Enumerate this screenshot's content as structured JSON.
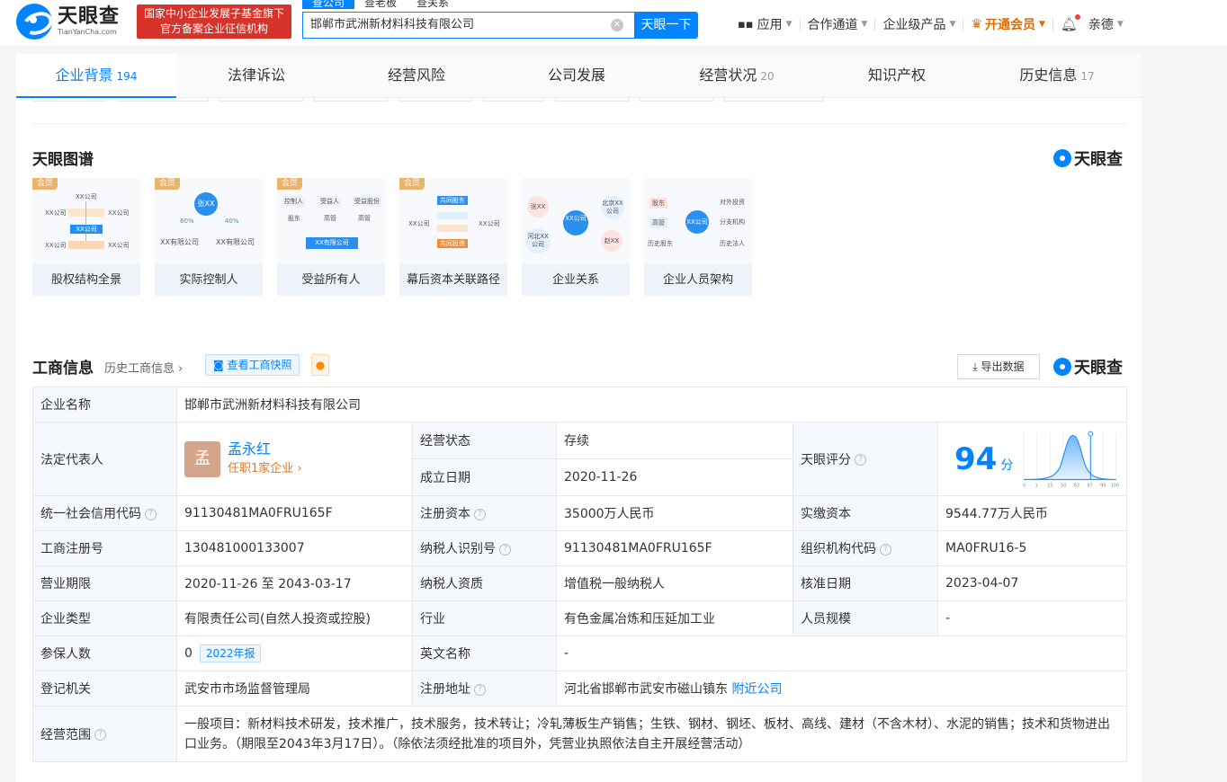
{
  "header": {
    "logo_cn": "天眼查",
    "logo_en": "TianYanCha.com",
    "gov_badge_line1": "国家中小企业发展子基金旗下",
    "gov_badge_line2": "官方备案企业征信机构",
    "search_tabs": [
      "查公司",
      "查老板",
      "查关系"
    ],
    "search_value": "邯郸市武洲新材料科技有限公司",
    "search_button": "天眼一下",
    "nav": {
      "apps": "应用",
      "partner": "合作通道",
      "enterprise": "企业级产品",
      "vip": "开通会员",
      "user": "亲德"
    }
  },
  "tabs": [
    {
      "label": "企业背景",
      "count": "194"
    },
    {
      "label": "法律诉讼",
      "count": ""
    },
    {
      "label": "经营风险",
      "count": ""
    },
    {
      "label": "公司发展",
      "count": ""
    },
    {
      "label": "经营状况",
      "count": "20"
    },
    {
      "label": "知识产权",
      "count": ""
    },
    {
      "label": "历史信息",
      "count": "17"
    }
  ],
  "graph_section": {
    "title": "天眼图谱",
    "brand": "天眼查",
    "tag": "会员",
    "cards": [
      {
        "label": "股权结构全景"
      },
      {
        "label": "实际控制人"
      },
      {
        "label": "受益所有人"
      },
      {
        "label": "幕后资本关联路径"
      },
      {
        "label": "企业关系"
      },
      {
        "label": "企业人员架构"
      }
    ],
    "thumb_texts": {
      "c1": [
        "XX公司",
        "XX公司",
        "XX公司",
        "XX公司",
        "XX公司",
        "XX公司",
        "XX公司"
      ],
      "c2": [
        "张XX",
        "60%",
        "40%",
        "XX有限公司",
        "XX有限公司"
      ],
      "c3": [
        "控制人",
        "受益人",
        "受益股份",
        "股东",
        "高管",
        "高管",
        "XX有限公司"
      ],
      "c4": [
        "共同股东",
        "XX公司",
        "XX公司",
        "共同投资"
      ],
      "c5": [
        "张XX",
        "XX公司",
        "北京XX公司",
        "河北XX公司",
        "赵XX"
      ],
      "c6": [
        "股东",
        "对外投资",
        "高管",
        "XX公司",
        "分支机构",
        "历史股东",
        "历史法人"
      ]
    }
  },
  "business_info": {
    "title": "工商信息",
    "history_link": "历史工商信息",
    "snapshot_button": "查看工商快照",
    "export_button": "导出数据",
    "brand": "天眼查",
    "rows": {
      "company_name_label": "企业名称",
      "company_name": "邯郸市武洲新材料科技有限公司",
      "legal_rep_label": "法定代表人",
      "legal_rep_avatar": "孟",
      "legal_rep_name": "孟永红",
      "legal_rep_sub": "任职1家企业",
      "status_label": "经营状态",
      "status": "存续",
      "established_label": "成立日期",
      "established": "2020-11-26",
      "score_label": "天眼评分",
      "score": "94",
      "score_unit": "分",
      "score_axis": [
        "0",
        "1",
        "15",
        "50",
        "83",
        "97",
        "99",
        "100"
      ],
      "credit_code_label": "统一社会信用代码",
      "credit_code": "91130481MA0FRU165F",
      "reg_capital_label": "注册资本",
      "reg_capital": "35000万人民币",
      "paid_capital_label": "实缴资本",
      "paid_capital": "9544.77万人民币",
      "reg_no_label": "工商注册号",
      "reg_no": "130481000133007",
      "taxpayer_id_label": "纳税人识别号",
      "taxpayer_id": "91130481MA0FRU165F",
      "org_code_label": "组织机构代码",
      "org_code": "MA0FRU16-5",
      "term_label": "营业期限",
      "term": "2020-11-26 至 2043-03-17",
      "taxpayer_qual_label": "纳税人资质",
      "taxpayer_qual": "增值税一般纳税人",
      "approval_label": "核准日期",
      "approval": "2023-04-07",
      "type_label": "企业类型",
      "type": "有限责任公司(自然人投资或控股)",
      "industry_label": "行业",
      "industry": "有色金属冶炼和压延加工业",
      "staff_label": "人员规模",
      "staff": "-",
      "insured_label": "参保人数",
      "insured": "0",
      "insured_year": "2022年报",
      "english_label": "英文名称",
      "english": "-",
      "authority_label": "登记机关",
      "authority": "武安市市场监督管理局",
      "address_label": "注册地址",
      "address": "河北省邯郸市武安市磁山镇东",
      "nearby": "附近公司",
      "scope_label": "经营范围",
      "scope": "一般项目：新材料技术研发，技术推广，技术服务，技术转让；冷轧薄板生产销售；生铁、钢材、钢坯、板材、高线、建材（不含木材）、水泥的销售；技术和货物进出口业务。（期限至2043年3月17日）。（除依法须经批准的项目外，凭营业执照依法自主开展经营活动）"
    }
  },
  "colors": {
    "accent": "#0084ff",
    "status_green": "#00a94f",
    "link_orange": "#e6781e",
    "badge_red": "#d6342a"
  }
}
